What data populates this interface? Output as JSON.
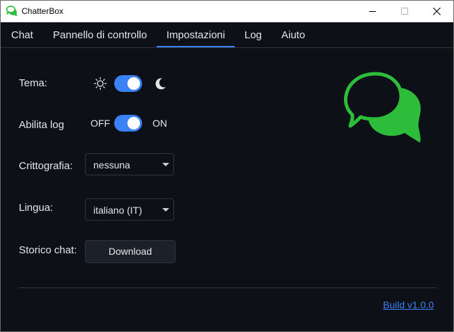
{
  "window": {
    "title": "ChatterBox"
  },
  "menu": {
    "items": [
      "Chat",
      "Pannello di controllo",
      "Impostazioni",
      "Log",
      "Aiuto"
    ],
    "active_index": 2
  },
  "settings": {
    "theme": {
      "label": "Tema:",
      "enabled": true,
      "left_icon": "sun-icon",
      "right_icon": "moon-icon"
    },
    "logging": {
      "label": "Abilita log",
      "off_label": "OFF",
      "on_label": "ON",
      "enabled": true
    },
    "encryption": {
      "label": "Crittografia:",
      "value": "nessuna"
    },
    "language": {
      "label": "Lingua:",
      "value": "italiano (IT)"
    },
    "history": {
      "label": "Storico chat:",
      "button_label": "Download"
    }
  },
  "footer": {
    "build_label": "Build v1.0.0"
  },
  "colors": {
    "accent": "#3b82f6",
    "brand_green": "#2ebd3a",
    "background": "#0d1117"
  }
}
